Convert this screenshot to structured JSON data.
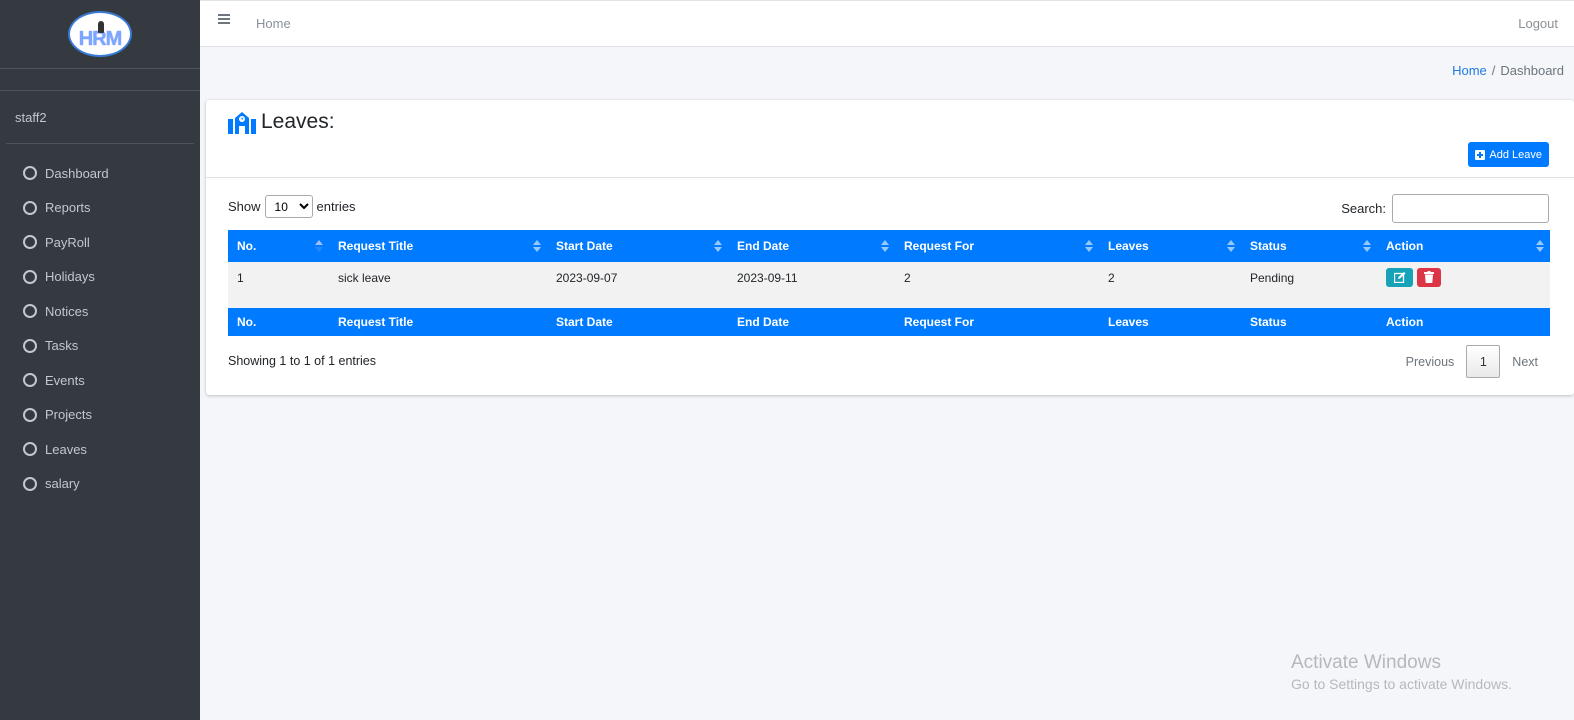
{
  "brand": {
    "logo_text": "HRM"
  },
  "user": {
    "name": "staff2"
  },
  "sidebar": {
    "items": [
      {
        "label": "Dashboard"
      },
      {
        "label": "Reports"
      },
      {
        "label": "PayRoll"
      },
      {
        "label": "Holidays"
      },
      {
        "label": "Notices"
      },
      {
        "label": "Tasks"
      },
      {
        "label": "Events"
      },
      {
        "label": "Projects"
      },
      {
        "label": "Leaves"
      },
      {
        "label": "salary"
      }
    ]
  },
  "navbar": {
    "home": "Home",
    "logout": "Logout"
  },
  "breadcrumb": {
    "home": "Home",
    "separator": "/",
    "current": "Dashboard"
  },
  "card": {
    "title": "Leaves:",
    "add_button": "Add Leave",
    "show_label": "Show",
    "entries_label": "entries",
    "page_length": "10",
    "search_label": "Search:",
    "search_value": ""
  },
  "table": {
    "columns": [
      "No.",
      "Request Title",
      "Start Date",
      "End Date",
      "Request For",
      "Leaves",
      "Status",
      "Action"
    ],
    "rows": [
      {
        "no": "1",
        "title": "sick leave",
        "start": "2023-09-07",
        "end": "2023-09-11",
        "request_for": "2",
        "leaves": "2",
        "status": "Pending"
      }
    ]
  },
  "footer": {
    "info": "Showing 1 to 1 of 1 entries",
    "previous": "Previous",
    "current_page": "1",
    "next": "Next"
  },
  "watermark": {
    "title": "Activate Windows",
    "subtitle": "Go to Settings to activate Windows."
  },
  "colors": {
    "primary": "#007bff",
    "sidebar": "#343a40",
    "edit": "#17a2b8",
    "delete": "#dc3545"
  }
}
